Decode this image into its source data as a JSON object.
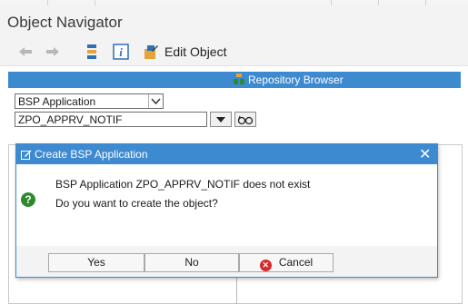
{
  "window": {
    "title": "Object Navigator"
  },
  "toolbar": {
    "back_icon": "back-arrow-icon",
    "forward_icon": "forward-arrow-icon",
    "hierarchy_icon": "hierarchy-icon",
    "info_icon": "info-icon",
    "edit_object_label": "Edit Object"
  },
  "repository": {
    "header_label": "Repository Browser",
    "object_type": "BSP Application",
    "object_name": "ZPO_APPRV_NOTIF"
  },
  "dialog": {
    "title": "Create BSP Application",
    "message_line1": "BSP Application ZPO_APPRV_NOTIF does not exist",
    "message_line2": "Do you want to create the object?",
    "icon": "question-icon",
    "buttons": {
      "yes": "Yes",
      "no": "No",
      "cancel": "Cancel"
    }
  },
  "colors": {
    "accent": "#3d8ad1",
    "question": "#2d8a2d",
    "cancel": "#d52b2b"
  }
}
